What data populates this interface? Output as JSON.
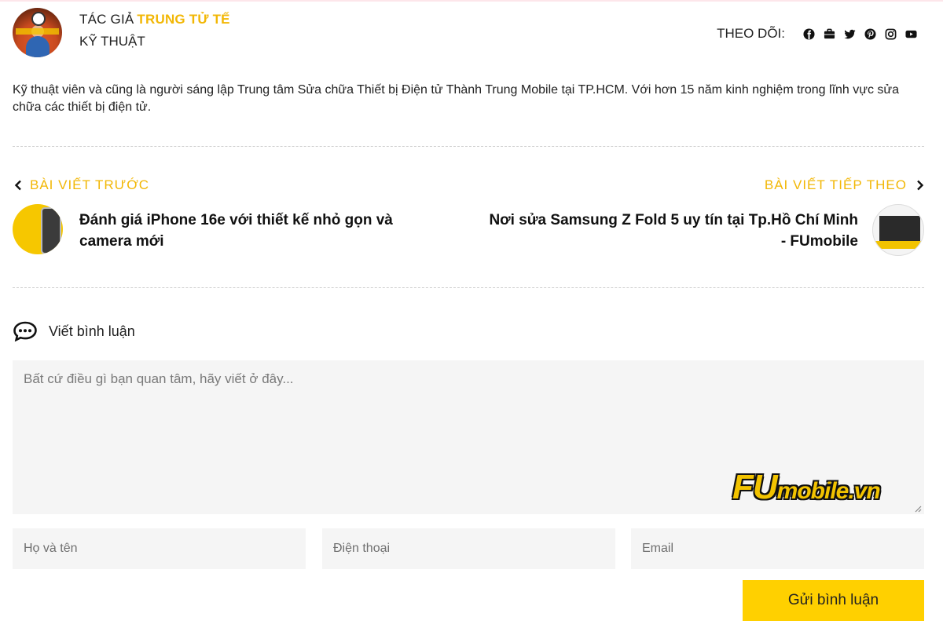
{
  "author": {
    "label": "TÁC GIẢ",
    "name": "TRUNG TỬ TẾ",
    "role": "KỸ THUẬT",
    "follow_label": "THEO DÕI:",
    "socials": [
      "facebook-icon",
      "briefcase-icon",
      "twitter-icon",
      "pinterest-icon",
      "instagram-icon",
      "youtube-icon"
    ],
    "bio": "Kỹ thuật viên và cũng là người sáng lập Trung tâm Sửa chữa Thiết bị Điện tử Thành Trung Mobile tại TP.HCM. Với hơn 15 năm kinh nghiệm trong lĩnh vực sửa chữa các thiết bị điện tử."
  },
  "navigation": {
    "prev_label": "BÀI VIẾT TRƯỚC",
    "next_label": "BÀI VIẾT TIẾP THEO",
    "prev_title": "Đánh giá iPhone 16e với thiết kế nhỏ gọn và camera mới",
    "next_title": "Nơi sửa Samsung Z Fold 5 uy tín tại Tp.Hồ Chí Minh - FUmobile"
  },
  "comment": {
    "title": "Viết bình luận",
    "placeholder": "Bất cứ điều gì bạn quan tâm, hãy viết ở đây...",
    "name_placeholder": "Họ và tên",
    "phone_placeholder": "Điện thoại",
    "email_placeholder": "Email",
    "submit_label": "Gửi bình luận"
  },
  "watermark": {
    "brand": "FU",
    "rest": "mobile.vn"
  },
  "colors": {
    "accent": "#f2b705",
    "button": "#ffd000",
    "field_bg": "#f5f5f5"
  }
}
